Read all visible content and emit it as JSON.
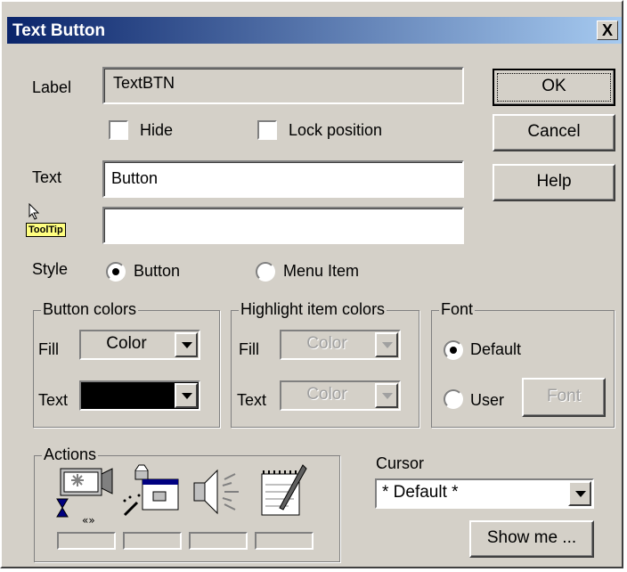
{
  "window": {
    "title": "Text Button",
    "close_glyph": "X"
  },
  "label_field": {
    "label": "Label",
    "value": "TextBTN"
  },
  "hide_checkbox": {
    "label": "Hide",
    "checked": false
  },
  "lock_checkbox": {
    "label": "Lock position",
    "checked": false
  },
  "text_field": {
    "label": "Text",
    "value": "Button"
  },
  "tooltip_field": {
    "badge": "ToolTip",
    "value": ""
  },
  "style": {
    "label": "Style",
    "options": [
      "Button",
      "Menu Item"
    ],
    "selected": "Button"
  },
  "buttons": {
    "ok": "OK",
    "cancel": "Cancel",
    "help": "Help",
    "show_me": "Show me ...",
    "font": "Font"
  },
  "button_colors": {
    "title": "Button colors",
    "fill_label": "Fill",
    "fill_value": "Color",
    "text_label": "Text",
    "text_value": "",
    "text_color": "#000000"
  },
  "highlight_colors": {
    "title": "Highlight item colors",
    "fill_label": "Fill",
    "fill_value": "Color",
    "text_label": "Text",
    "text_value": "Color"
  },
  "font_group": {
    "title": "Font",
    "options": [
      "Default",
      "User"
    ],
    "selected": "Default"
  },
  "actions": {
    "title": "Actions",
    "icons": [
      "movie-icon",
      "animation-icon",
      "speaker-icon",
      "notepad-icon"
    ]
  },
  "cursor": {
    "label": "Cursor",
    "value": "* Default *"
  },
  "colors": {
    "title_bar_start": "#0a246a",
    "title_bar_end": "#a6caf0",
    "dialog_bg": "#d4d0c8",
    "tooltip_badge": "#ffff80"
  }
}
